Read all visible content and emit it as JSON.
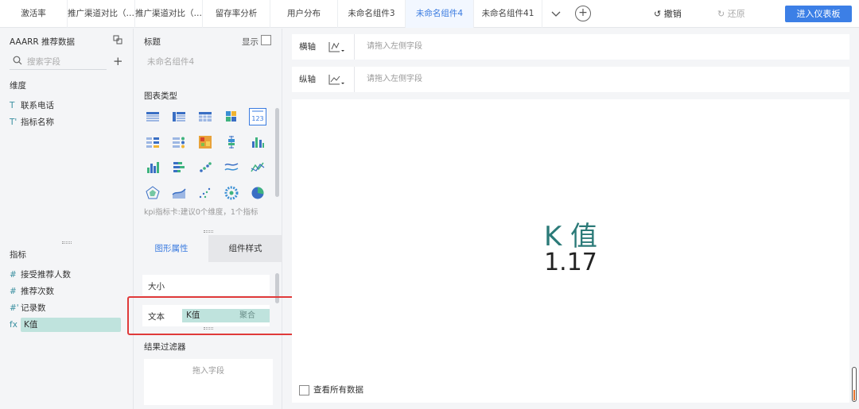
{
  "tabs": [
    {
      "label": "激活率",
      "active": false
    },
    {
      "label": "推广渠道对比（…",
      "active": false
    },
    {
      "label": "推广渠道对比（…",
      "active": false
    },
    {
      "label": "留存率分析",
      "active": false
    },
    {
      "label": "用户分布",
      "active": false
    },
    {
      "label": "未命名组件3",
      "active": false
    },
    {
      "label": "未命名组件4",
      "active": true
    },
    {
      "label": "未命名组件41",
      "active": false
    }
  ],
  "toolbar": {
    "undo_label": "撤销",
    "redo_label": "还原",
    "enter_dashboard_label": "进入仪表板"
  },
  "left_panel": {
    "dataset_title": "AAARR 推荐数据",
    "search_placeholder": "搜索字段",
    "dimensions_label": "维度",
    "dimensions": [
      {
        "icon": "T",
        "label": "联系电话"
      },
      {
        "icon": "T'",
        "label": "指标名称"
      }
    ],
    "metrics_label": "指标",
    "metrics": [
      {
        "icon": "#",
        "label": "接受推荐人数"
      },
      {
        "icon": "#",
        "label": "推荐次数"
      },
      {
        "icon": "#'",
        "label": "记录数"
      },
      {
        "icon": "fx",
        "label": "K值",
        "selected": true
      }
    ]
  },
  "middle_panel": {
    "title_label": "标题",
    "show_label": "显示",
    "title_value": "未命名组件4",
    "chart_type_label": "图表类型",
    "chart_hint": "kpi指标卡:建议0个维度，1个指标",
    "tab_graphic_props": "图形属性",
    "tab_component_style": "组件样式",
    "size_label": "大小",
    "text_label": "文本",
    "text_field": "K值",
    "text_agg": "聚合",
    "result_filter_label": "结果过滤器",
    "drop_field_hint": "拖入字段"
  },
  "axes": {
    "x_label": "横轴",
    "y_label": "纵轴",
    "x_hint": "请拖入左侧字段",
    "y_hint": "请拖入左侧字段"
  },
  "canvas": {
    "kpi_name": "K 值",
    "kpi_value": "1.17",
    "view_all_label": "查看所有数据"
  },
  "colors": {
    "accent": "#3a7be0",
    "kpi_teal": "#2b7a78",
    "field_tag": "#bfe3dd",
    "highlight": "#e03a3a"
  }
}
